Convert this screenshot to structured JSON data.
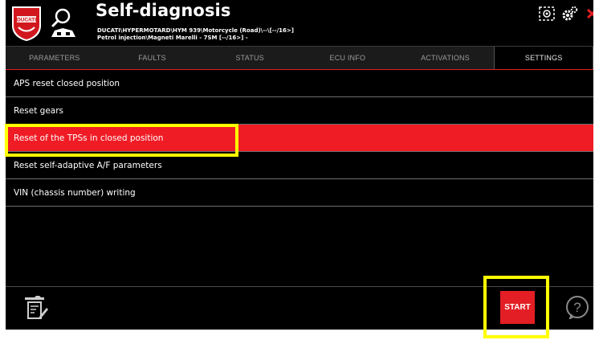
{
  "header": {
    "title": "Self-diagnosis",
    "path_line1": "DUCATI\\HYPERMOTARD\\HYM 939\\Motorcycle (Road)\\--\\[--/16>]",
    "path_line2": "Petrol injection\\Magneti Marelli - 7SM [--/16>] -",
    "logo_text": "DUCATI"
  },
  "tabs": [
    {
      "label": "PARAMETERS"
    },
    {
      "label": "FAULTS"
    },
    {
      "label": "STATUS"
    },
    {
      "label": "ECU INFO"
    },
    {
      "label": "ACTIVATIONS"
    },
    {
      "label": "SETTINGS",
      "active": true
    }
  ],
  "list": {
    "items": [
      {
        "label": "APS reset closed position"
      },
      {
        "label": "Reset gears"
      },
      {
        "label": "Reset of the TPSs in closed position",
        "selected": true
      },
      {
        "label": "Reset self-adaptive A/F parameters"
      },
      {
        "label": "VIN (chassis number) writing"
      }
    ]
  },
  "footer": {
    "start_label": "START",
    "help_glyph": "?"
  },
  "icons": {
    "logo": "ducati-logo-icon",
    "search": "search-vehicle-icon",
    "screen_capture": "screen-capture-icon",
    "settings_gear": "gear-icon",
    "close": "close-icon",
    "settings_edit": "edit-settings-icon",
    "help": "help-icon"
  },
  "colors": {
    "accent": "#e31e24",
    "highlight": "#ffff00",
    "background": "#000000"
  }
}
